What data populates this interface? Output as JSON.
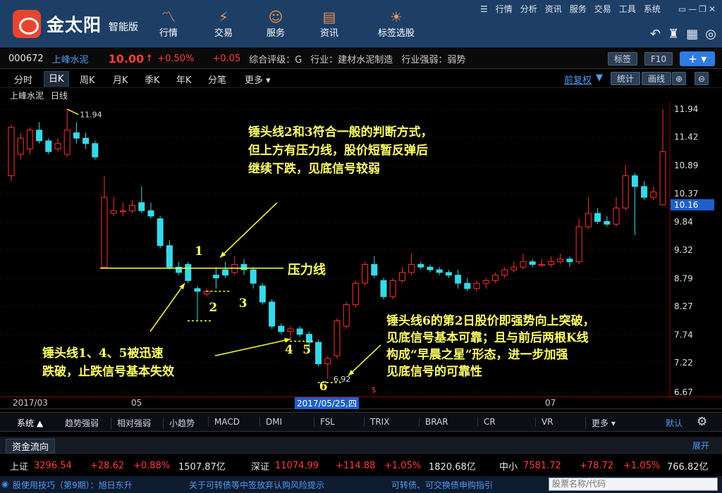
{
  "app": {
    "name": "金太阳",
    "edition": "智能版"
  },
  "nav": [
    {
      "label": "行情",
      "icon": "trend-icon"
    },
    {
      "label": "交易",
      "icon": "trade-icon"
    },
    {
      "label": "服务",
      "icon": "user-icon"
    },
    {
      "label": "资讯",
      "icon": "news-icon"
    },
    {
      "label": "标签选股",
      "icon": "bulb-icon"
    }
  ],
  "top_menu": [
    "行情",
    "分析",
    "资讯",
    "服务",
    "交易",
    "工具",
    "系统"
  ],
  "quote": {
    "code": "000672",
    "name": "上峰水泥",
    "price": "10.00",
    "arrow": "↑",
    "pct": "+0.50%",
    "chg": "+0.05",
    "rating": "综合评级：G",
    "industry": "行业：建材水泥制造",
    "ind_strength": "行业强弱：弱势"
  },
  "buttons": {
    "board": "标签",
    "f10": "F10",
    "plus": "+ ▾",
    "restore": "前复权",
    "stat": "统计",
    "draw": "画线"
  },
  "period_tabs": [
    "分时",
    "日K",
    "周K",
    "月K",
    "季K",
    "年K",
    "分笔",
    "更多 ▾"
  ],
  "chart_title": {
    "name": "上峰水泥",
    "period": "日线"
  },
  "chart_data": {
    "type": "candlestick",
    "y_ticks": [
      11.94,
      11.42,
      10.89,
      10.37,
      9.84,
      9.32,
      8.79,
      8.27,
      7.74,
      7.22,
      6.67
    ],
    "price_tag": "10.16",
    "high_label": "11.94",
    "low_label": "6.92",
    "x_labels": [
      "2017/03",
      "05",
      "07"
    ],
    "cursor_date": "2017/05/25,四",
    "candles": [
      [
        10.7,
        11.6,
        11.65,
        10.6
      ],
      [
        11.1,
        11.4,
        11.5,
        11.0
      ],
      [
        11.2,
        11.55,
        11.6,
        11.1
      ],
      [
        11.55,
        11.35,
        11.7,
        11.3
      ],
      [
        11.35,
        11.15,
        11.4,
        11.1
      ],
      [
        11.2,
        11.3,
        11.4,
        11.15
      ],
      [
        11.1,
        11.55,
        11.94,
        11.05
      ],
      [
        11.5,
        11.4,
        11.7,
        11.3
      ],
      [
        11.4,
        11.3,
        11.5,
        11.2
      ],
      [
        11.3,
        11.05,
        11.35,
        11.0
      ],
      [
        9.0,
        10.3,
        10.7,
        9.0
      ],
      [
        10.0,
        10.05,
        10.3,
        9.95
      ],
      [
        10.05,
        10.05,
        10.2,
        9.95
      ],
      [
        10.05,
        10.15,
        10.25,
        10.0
      ],
      [
        10.2,
        10.05,
        10.5,
        10.0
      ],
      [
        10.05,
        9.95,
        10.2,
        9.9
      ],
      [
        9.9,
        9.4,
        9.95,
        9.35
      ],
      [
        9.4,
        9.0,
        9.5,
        8.95
      ],
      [
        9.0,
        8.9,
        9.1,
        8.85
      ],
      [
        9.05,
        8.75,
        9.1,
        8.7
      ],
      [
        8.6,
        8.55,
        8.65,
        8.0
      ],
      [
        8.5,
        8.55,
        8.6,
        8.45
      ],
      [
        8.85,
        8.8,
        9.0,
        8.6
      ],
      [
        8.95,
        8.85,
        9.1,
        8.8
      ],
      [
        8.9,
        9.05,
        9.2,
        8.85
      ],
      [
        9.05,
        8.95,
        9.15,
        8.85
      ],
      [
        8.95,
        8.7,
        9.0,
        8.6
      ],
      [
        8.65,
        8.35,
        8.7,
        8.3
      ],
      [
        8.35,
        7.9,
        8.4,
        7.85
      ],
      [
        7.9,
        7.8,
        7.95,
        7.75
      ],
      [
        7.8,
        7.85,
        7.9,
        7.65
      ],
      [
        7.85,
        7.75,
        7.9,
        7.7
      ],
      [
        7.75,
        7.6,
        7.8,
        7.5
      ],
      [
        7.6,
        7.2,
        7.65,
        7.15
      ],
      [
        7.2,
        7.3,
        7.35,
        6.92
      ],
      [
        7.35,
        8.0,
        8.05,
        7.3
      ],
      [
        7.9,
        8.3,
        8.35,
        7.85
      ],
      [
        8.3,
        8.7,
        8.75,
        8.25
      ],
      [
        8.7,
        9.05,
        9.1,
        8.65
      ],
      [
        9.05,
        8.85,
        9.2,
        8.8
      ],
      [
        8.75,
        8.45,
        8.8,
        8.4
      ],
      [
        8.45,
        8.75,
        8.8,
        8.4
      ],
      [
        8.75,
        8.9,
        9.0,
        8.7
      ],
      [
        8.9,
        9.05,
        9.25,
        8.85
      ],
      [
        9.05,
        9.0,
        9.1,
        8.95
      ],
      [
        9.0,
        8.95,
        9.05,
        8.9
      ],
      [
        8.95,
        8.9,
        9.0,
        8.85
      ],
      [
        8.9,
        8.85,
        8.95,
        8.8
      ],
      [
        8.85,
        8.7,
        8.95,
        8.6
      ],
      [
        8.7,
        8.6,
        8.8,
        8.55
      ],
      [
        8.6,
        8.7,
        8.75,
        8.55
      ],
      [
        8.7,
        8.75,
        8.8,
        8.6
      ],
      [
        8.75,
        8.85,
        8.9,
        8.7
      ],
      [
        8.85,
        8.95,
        9.0,
        8.8
      ],
      [
        8.95,
        9.0,
        9.1,
        8.9
      ],
      [
        9.0,
        9.1,
        9.25,
        8.95
      ],
      [
        9.1,
        9.05,
        9.15,
        9.0
      ],
      [
        9.05,
        9.05,
        9.15,
        9.0
      ],
      [
        9.05,
        9.1,
        9.2,
        9.0
      ],
      [
        9.1,
        9.15,
        9.25,
        9.05
      ],
      [
        9.15,
        9.1,
        9.2,
        9.0
      ],
      [
        9.1,
        9.75,
        9.9,
        9.05
      ],
      [
        9.75,
        10.0,
        10.3,
        9.7
      ],
      [
        10.0,
        9.85,
        10.1,
        9.8
      ],
      [
        9.85,
        9.8,
        9.95,
        9.75
      ],
      [
        9.8,
        10.1,
        10.3,
        9.75
      ],
      [
        10.1,
        10.7,
        10.9,
        10.05
      ],
      [
        10.7,
        10.5,
        10.75,
        9.6
      ],
      [
        10.5,
        10.3,
        10.6,
        10.25
      ],
      [
        10.3,
        10.4,
        10.5,
        10.25
      ],
      [
        10.16,
        11.15,
        11.94,
        10.15
      ]
    ]
  },
  "annotations": {
    "a1": "锤头线2和3符合一般的判断方式，\n但上方有压力线，股价短暂反弹后\n继续下跌，见底信号较弱",
    "a2": "锤头线1、4、5被迅速\n跌破，止跌信号基本失效",
    "a3": "锤头线6的第2日股价即强势向上突破，\n见底信号基本可靠；且与前后两根K线\n构成“早晨之星”形态，进一步加强\n见底信号的可靠性",
    "pressure": "压力线",
    "n1": "1",
    "n2": "2",
    "n3": "3",
    "n4": "4",
    "n5": "5",
    "n6": "6"
  },
  "indicator_tabs": {
    "system": "系统 ▲",
    "items": [
      "趋势强弱",
      "相对强弱",
      "小趋势",
      "MACD",
      "DMI",
      "FSL",
      "TRIX",
      "BRAR",
      "CR",
      "VR",
      "更多 ▾"
    ],
    "default": "默认"
  },
  "flow": {
    "label": "资金流向",
    "expand": "展开"
  },
  "indices": [
    {
      "name": "上证",
      "value": "3296.54",
      "chg": "+28.62",
      "pct": "+0.88%",
      "amt": "1507.87亿"
    },
    {
      "name": "深证",
      "value": "11074.99",
      "chg": "+114.88",
      "pct": "+1.05%",
      "amt": "1820.68亿"
    },
    {
      "name": "中小",
      "value": "7581.72",
      "chg": "+78.72",
      "pct": "+1.05%",
      "amt": "766.82亿"
    }
  ],
  "status": {
    "s1": "股使用技巧（第9期）：旭日东升",
    "s2": "关于可转债等中签放弃认购风险提示",
    "s3": "可转债、可交换债申购指引",
    "search": "股票名称/代码"
  }
}
